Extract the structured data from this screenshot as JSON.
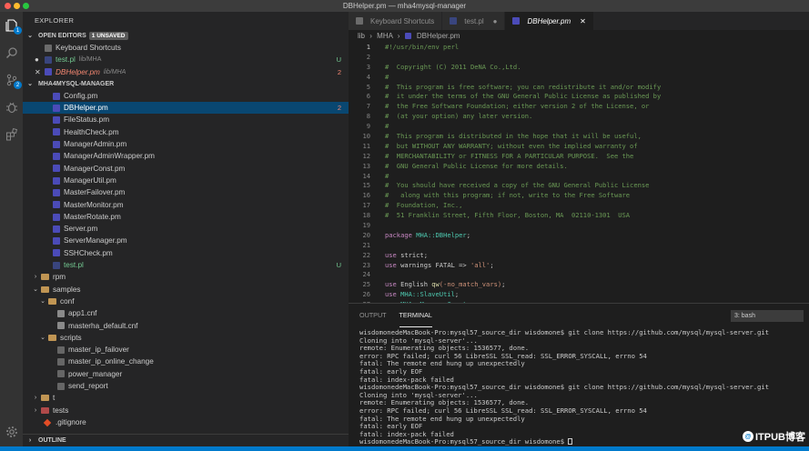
{
  "window": {
    "title": "DBHelper.pm — mha4mysql-manager"
  },
  "activity_bar": {
    "scm_badge": "2",
    "explorer_badge": "1"
  },
  "sidebar": {
    "title": "EXPLORER",
    "open_editors": {
      "label": "OPEN EDITORS",
      "unsaved": "1 UNSAVED",
      "items": [
        {
          "name": "Keyboard Shortcuts",
          "path": "",
          "decoration": ""
        },
        {
          "name": "test.pl",
          "path": "lib/MHA",
          "decoration": "U"
        },
        {
          "name": "DBHelper.pm",
          "path": "lib/MHA",
          "decoration": "2"
        }
      ]
    },
    "project": {
      "label": "MHA4MYSQL-MANAGER",
      "mha_files": [
        {
          "name": "Config.pm",
          "decoration": ""
        },
        {
          "name": "DBHelper.pm",
          "decoration": "2"
        },
        {
          "name": "FileStatus.pm",
          "decoration": ""
        },
        {
          "name": "HealthCheck.pm",
          "decoration": ""
        },
        {
          "name": "ManagerAdmin.pm",
          "decoration": ""
        },
        {
          "name": "ManagerAdminWrapper.pm",
          "decoration": ""
        },
        {
          "name": "ManagerConst.pm",
          "decoration": ""
        },
        {
          "name": "ManagerUtil.pm",
          "decoration": ""
        },
        {
          "name": "MasterFailover.pm",
          "decoration": ""
        },
        {
          "name": "MasterMonitor.pm",
          "decoration": ""
        },
        {
          "name": "MasterRotate.pm",
          "decoration": ""
        },
        {
          "name": "Server.pm",
          "decoration": ""
        },
        {
          "name": "ServerManager.pm",
          "decoration": ""
        },
        {
          "name": "SSHCheck.pm",
          "decoration": ""
        },
        {
          "name": "test.pl",
          "decoration": "U"
        }
      ],
      "rpm": "rpm",
      "samples": "samples",
      "conf": "conf",
      "conf_files": [
        "app1.cnf",
        "masterha_default.cnf"
      ],
      "scripts": "scripts",
      "script_files": [
        "master_ip_failover",
        "master_ip_online_change",
        "power_manager",
        "send_report"
      ],
      "t": "t",
      "tests": "tests",
      "gitignore": ".gitignore"
    },
    "outline": "OUTLINE"
  },
  "editor": {
    "tabs": [
      {
        "label": "Keyboard Shortcuts"
      },
      {
        "label": "test.pl"
      },
      {
        "label": "DBHelper.pm"
      }
    ],
    "breadcrumb": [
      "lib",
      "MHA",
      "DBHelper.pm"
    ],
    "code_lines": [
      "#!/usr/bin/env perl",
      "",
      "#  Copyright (C) 2011 DeNA Co.,Ltd.",
      "#",
      "#  This program is free software; you can redistribute it and/or modify",
      "#  it under the terms of the GNU General Public License as published by",
      "#  the Free Software Foundation; either version 2 of the License, or",
      "#  (at your option) any later version.",
      "#",
      "#  This program is distributed in the hope that it will be useful,",
      "#  but WITHOUT ANY WARRANTY; without even the implied warranty of",
      "#  MERCHANTABILITY or FITNESS FOR A PARTICULAR PURPOSE.  See the",
      "#  GNU General Public License for more details.",
      "#",
      "#  You should have received a copy of the GNU General Public License",
      "#   along with this program; if not, write to the Free Software",
      "#  Foundation, Inc.,",
      "#  51 Franklin Street, Fifth Floor, Boston, MA  02110-1301  USA",
      "",
      "package MHA::DBHelper;",
      "",
      "use strict;",
      "use warnings FATAL => 'all';",
      "",
      "use English qw(-no_match_vars);",
      "use MHA::SlaveUtil;",
      "use MHA::ManagerConst;"
    ]
  },
  "panel": {
    "tabs": [
      "OUTPUT",
      "TERMINAL"
    ],
    "terminal_select": "3: bash",
    "terminal_lines": [
      "wisdomonedeMacBook-Pro:mysql57_source_dir wisdomone$ git clone https://github.com/mysql/mysql-server.git",
      "Cloning into 'mysql-server'...",
      "remote: Enumerating objects: 1536577, done.",
      "error: RPC failed; curl 56 LibreSSL SSL_read: SSL_ERROR_SYSCALL, errno 54",
      "fatal: The remote end hung up unexpectedly",
      "fatal: early EOF",
      "fatal: index-pack failed",
      "wisdomonedeMacBook-Pro:mysql57_source_dir wisdomone$ git clone https://github.com/mysql/mysql-server.git",
      "Cloning into 'mysql-server'...",
      "remote: Enumerating objects: 1536577, done.",
      "error: RPC failed; curl 56 LibreSSL SSL_read: SSL_ERROR_SYSCALL, errno 54",
      "fatal: The remote end hung up unexpectedly",
      "fatal: early EOF",
      "fatal: index-pack failed",
      "wisdomonedeMacBook-Pro:mysql57_source_dir wisdomone$ "
    ]
  },
  "watermark": {
    "text": "ITPUB博客"
  }
}
